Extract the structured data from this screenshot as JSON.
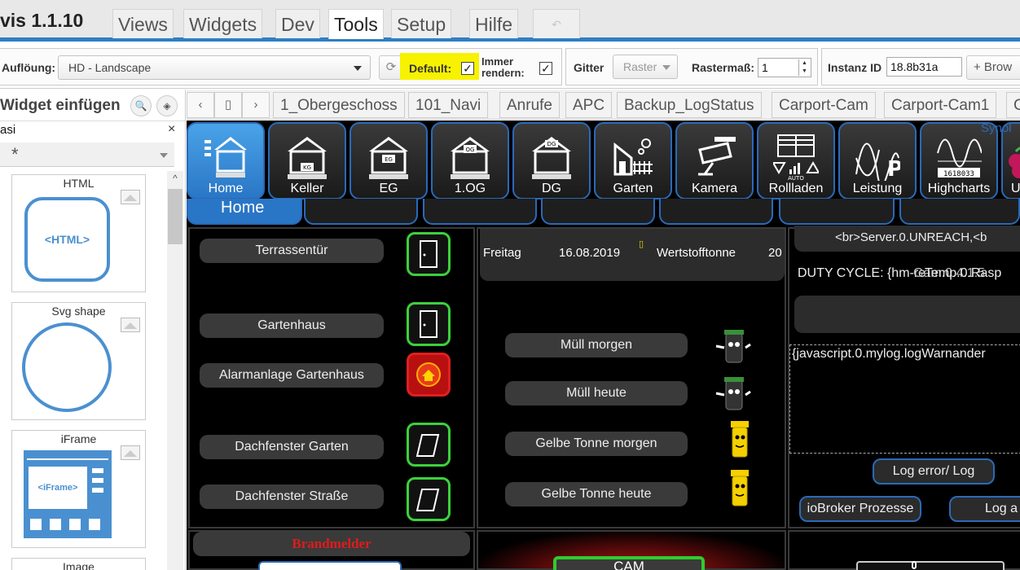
{
  "app": {
    "title": "vis 1.1.10"
  },
  "menu": {
    "tabs": [
      {
        "label": "Views"
      },
      {
        "label": "Widgets"
      },
      {
        "label": "Dev"
      },
      {
        "label": "Tools"
      },
      {
        "label": "Setup"
      },
      {
        "label": "Hilfe"
      }
    ],
    "undo": "↶"
  },
  "toolbar": {
    "resolution_label": "Auflöung:",
    "resolution_value": "HD - Landscape",
    "default_label": "Default:",
    "always_render_label_1": "Immer",
    "always_render_label_2": "rendern:",
    "gitter_label": "Gitter",
    "raster_value": "Raster",
    "rastermass_label": "Rastermaß:",
    "rastermass_value": "1",
    "instanz_label": "Instanz ID",
    "instanz_value": "18.8b31a",
    "browse_label": "+ Brow",
    "highlight_color": "#f6f200"
  },
  "left": {
    "title": "Widget einfügen",
    "filter": "asi",
    "clear": "×",
    "set": "*",
    "widgets": [
      {
        "title": "HTML",
        "preview": "<HTML>"
      },
      {
        "title": "Svg shape"
      },
      {
        "title": "iFrame",
        "preview": "<iFrame>"
      },
      {
        "title": "Image"
      }
    ]
  },
  "views": {
    "tabs": [
      "1_Obergeschoss",
      "101_Navi",
      "Anrufe",
      "APC",
      "Backup_LogStatus",
      "Carport-Cam",
      "Carport-Cam1",
      "C"
    ]
  },
  "canvas": {
    "nav_tiles": [
      "Home",
      "Keller",
      "EG",
      "1.OG",
      "DG",
      "Garten",
      "Kamera",
      "Rollladen",
      "Leistung",
      "Highcharts",
      "U"
    ],
    "corner_text": "Synol",
    "subnav_active": "Home",
    "left_panel": {
      "items": [
        "Terrassentür",
        "Gartenhaus",
        "Alarmanlage Gartenhaus",
        "Dachfenster Garten",
        "Dachfenster Straße"
      ],
      "brandmelder": "Brandmelder"
    },
    "middle_panel": {
      "day": "Freitag",
      "date": "16.08.2019",
      "type": "Wertstofftonne",
      "days": "20",
      "items": [
        "Müll morgen",
        "Müll heute",
        "Gelbe Tonne morgen",
        "Gelbe Tonne heute"
      ],
      "cam": "CAM"
    },
    "right_panel": {
      "server_text": "<br>Server.0.UNREACH,<b",
      "duty_label": "DUTY CYCLE: {hm-re",
      "duty_overlay": "Temp.0.Rasp",
      "duty_overlay2": "Gam.0.4.1.5",
      "log_text": "{javascript.0.mylog.logWarnander",
      "log_button": "Log error/ Log",
      "process_button": "ioBroker Prozesse",
      "log2_button": "Log a"
    }
  }
}
